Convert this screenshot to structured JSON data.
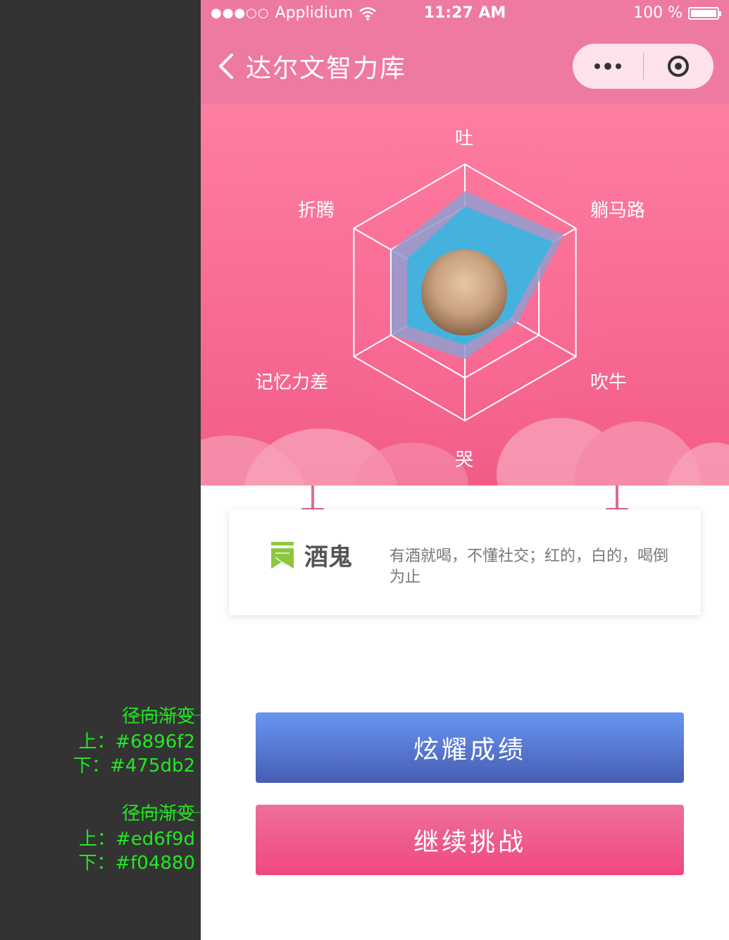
{
  "annotations": [
    {
      "heading": "径向渐变",
      "top": "上：#6896f2",
      "bottom": "下：#475db2"
    },
    {
      "heading": "径向渐变",
      "top": "上：#ed6f9d",
      "bottom": "下：#f04880"
    }
  ],
  "status_bar": {
    "carrier": "Applidium",
    "signal_dots": "●●●○○",
    "time": "11:27 AM",
    "battery": "100 %"
  },
  "nav": {
    "title": "达尔文智力库",
    "back_icon": "chevron-left-icon",
    "more_icon": "more-dots-icon",
    "close_icon": "target-circle-icon"
  },
  "radar": {
    "axes": [
      "吐",
      "躺马路",
      "吹牛",
      "哭",
      "记忆力差",
      "折腾"
    ],
    "levels": 3,
    "values_outer": [
      0.79,
      0.89,
      0.47,
      0.52,
      0.66,
      0.66
    ],
    "values_inner": [
      0.67,
      0.79,
      0.41,
      0.41,
      0.52,
      0.52
    ],
    "outer_color": "#8f9fd0",
    "inner_color": "#3fb3de"
  },
  "result": {
    "name": "酒鬼",
    "description": "有酒就喝，不懂社交；红的，白的，喝倒为止",
    "badge_icon": "bookmark-icon"
  },
  "buttons": {
    "show_score": "炫耀成绩",
    "continue": "继续挑战"
  },
  "colors": {
    "nav_bg": "#ee7aa0",
    "hero_top": "#fe7ea2",
    "hero_bottom": "#f25c87",
    "blue_top": "#6896f2",
    "blue_bottom": "#475db2",
    "pink_top": "#ed6f9d",
    "pink_bottom": "#f04880",
    "annotation": "#22e822"
  }
}
